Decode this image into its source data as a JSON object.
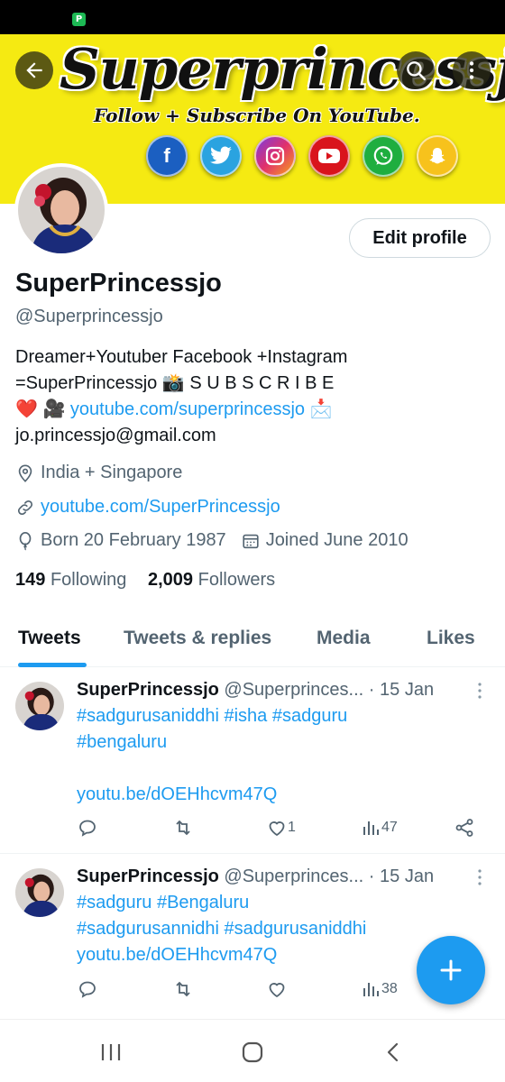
{
  "banner": {
    "title": "Superprincessjo",
    "subtitle": "Follow + Subscribe On YouTube.",
    "social_icons": [
      {
        "name": "facebook-icon",
        "glyph": "f",
        "color": "#1b5fc1"
      },
      {
        "name": "twitter-icon",
        "glyph": "🐦",
        "color": "#2aa3e0"
      },
      {
        "name": "instagram-icon",
        "glyph": "◎",
        "color": "#d6336c"
      },
      {
        "name": "youtube-icon",
        "glyph": "▶",
        "color": "#d9141c"
      },
      {
        "name": "whatsapp-icon",
        "glyph": "✆",
        "color": "#1fae3f"
      },
      {
        "name": "snapchat-icon",
        "glyph": "👻",
        "color": "#f7c21c"
      }
    ]
  },
  "profile": {
    "edit_label": "Edit profile",
    "display_name": "SuperPrincessjo",
    "handle": "@Superprincessjo",
    "bio_line1": "Dreamer+Youtuber  Facebook +Instagram",
    "bio_line2": "=SuperPrincessjo 📸 S U B S C R I B E",
    "bio_line3_prefix": "❤️ 🎥 ",
    "bio_link": "youtube.com/superprincessjo",
    "bio_line3_suffix": " 📩",
    "bio_line4": "jo.princessjo@gmail.com",
    "location": "India + Singapore",
    "website": "youtube.com/SuperPrincessjo",
    "born": "Born 20 February 1987",
    "joined": "Joined June 2010",
    "following_count": "149",
    "following_label": "Following",
    "followers_count": "2,009",
    "followers_label": "Followers"
  },
  "tabs": [
    {
      "label": "Tweets"
    },
    {
      "label": "Tweets & replies"
    },
    {
      "label": "Media"
    },
    {
      "label": "Likes"
    }
  ],
  "tweets": [
    {
      "name": "SuperPrincessjo",
      "handle": "@Superprinces...",
      "date": "· 15 Jan",
      "body_line1": "#sadgurusaniddhi #isha #sadguru",
      "body_line2": "#bengaluru",
      "body_line3": "",
      "body_line4": "youtu.be/dOEHhcvm47Q",
      "likes": "1",
      "views": "47"
    },
    {
      "name": "SuperPrincessjo",
      "handle": "@Superprinces...",
      "date": "· 15 Jan",
      "body_line1": "#sadguru #Bengaluru",
      "body_line2": "#sadgurusannidhi #sadgurusaniddhi",
      "body_line3": "youtu.be/dOEHhcvm47Q",
      "views": "38"
    }
  ],
  "colors": {
    "accent": "#1d9bf0",
    "banner_bg": "#f5ea12",
    "text_secondary": "#536471"
  }
}
